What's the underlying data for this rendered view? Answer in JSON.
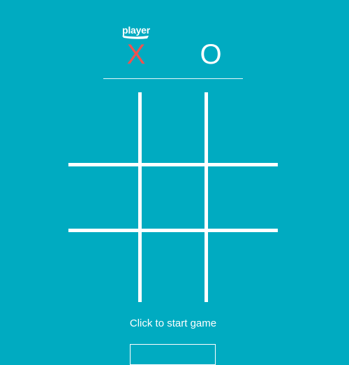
{
  "game": {
    "current_player_label": "player",
    "players": {
      "x": {
        "symbol": "X",
        "color": "#ef5350"
      },
      "o": {
        "symbol": "O",
        "color": "#ffffff"
      }
    },
    "board": [
      [
        "",
        "",
        ""
      ],
      [
        "",
        "",
        ""
      ],
      [
        "",
        "",
        ""
      ]
    ],
    "status": "Click to start game"
  },
  "colors": {
    "background": "#00abc1",
    "foreground": "#ffffff",
    "x_color": "#ef5350"
  }
}
